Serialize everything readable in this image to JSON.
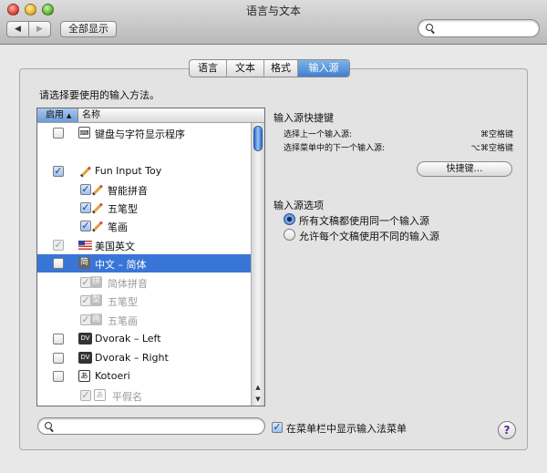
{
  "window": {
    "title": "语言与文本"
  },
  "toolbar": {
    "back_glyph": "◀",
    "forward_glyph": "▶",
    "show_all_label": "全部显示",
    "search_value": ""
  },
  "tabs": [
    {
      "label": "语言",
      "active": false
    },
    {
      "label": "文本",
      "active": false
    },
    {
      "label": "格式",
      "active": false
    },
    {
      "label": "输入源",
      "active": true
    }
  ],
  "instructions": "请选择要使用的输入方法。",
  "list": {
    "header_enabled": "启用",
    "header_sort_glyph": "▲",
    "header_name": "名称",
    "items": [
      {
        "label": "键盘与字符显示程序",
        "checked": false,
        "icon": "keyboard-viewer-icon",
        "icon_glyph": "⌨"
      },
      {
        "label": "Fun Input Toy",
        "checked": true,
        "icon": "pencil-icon"
      },
      {
        "label": "智能拼音",
        "checked": true,
        "icon": "pencil-icon"
      },
      {
        "label": "五笔型",
        "checked": true,
        "icon": "pencil-icon"
      },
      {
        "label": "笔画",
        "checked": true,
        "icon": "pencil-icon"
      },
      {
        "label": "美国英文",
        "checked": true,
        "icon": "us-flag-icon"
      },
      {
        "label": "中文 – 简体",
        "checked": false,
        "icon": "simplified-chinese-icon",
        "icon_glyph": "简",
        "selected": true
      },
      {
        "label": "简体拼音",
        "checked": true,
        "icon": "pinyin-icon",
        "icon_glyph": "拼"
      },
      {
        "label": "五笔型",
        "checked": true,
        "icon": "wubi-icon",
        "icon_glyph": "型"
      },
      {
        "label": "五笔画",
        "checked": true,
        "icon": "stroke-icon",
        "icon_glyph": "画"
      },
      {
        "label": "Dvorak – Left",
        "checked": false,
        "icon": "dvorak-icon",
        "icon_glyph": "DV"
      },
      {
        "label": "Dvorak – Right",
        "checked": false,
        "icon": "dvorak-icon",
        "icon_glyph": "DV"
      },
      {
        "label": "Kotoeri",
        "checked": false,
        "icon": "kotoeri-icon",
        "icon_glyph": "あ"
      },
      {
        "label": "平假名",
        "checked": true,
        "icon": "hiragana-icon",
        "icon_glyph": "あ"
      }
    ],
    "check_glyph": "✓",
    "scroll_up_glyph": "▲",
    "scroll_down_glyph": "▼"
  },
  "shortcuts": {
    "title": "输入源快捷键",
    "prev_label": "选择上一个输入源:",
    "prev_keys": "⌘空格键",
    "next_label": "选择菜单中的下一个输入源:",
    "next_keys": "⌥⌘空格键",
    "button_label": "快捷键…"
  },
  "options": {
    "title": "输入源选项",
    "radio_same": "所有文稿都使用同一个输入源",
    "radio_different": "允许每个文稿使用不同的输入源",
    "selected": "same"
  },
  "bottom": {
    "search_value": "",
    "show_menu_label": "在菜单栏中显示输入法菜单",
    "show_menu_checked": true,
    "help_glyph": "?"
  }
}
